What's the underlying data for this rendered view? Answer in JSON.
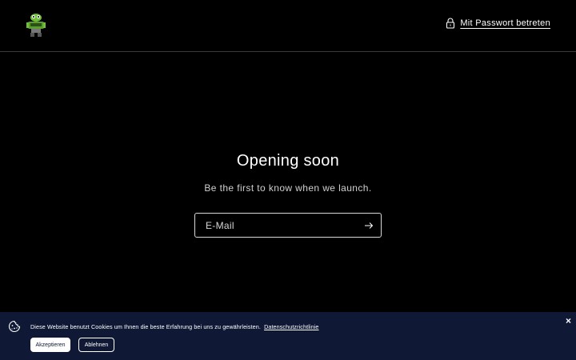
{
  "header": {
    "logo_icon": "robot-mascot-icon",
    "lock_icon": "lock-icon",
    "password_link": "Mit Passwort betreten"
  },
  "main": {
    "title": "Opening soon",
    "subtitle": "Be the first to know when we launch.",
    "email_placeholder": "E-Mail",
    "submit_icon": "arrow-right-icon"
  },
  "cookie_banner": {
    "icon": "cookie-icon",
    "text": "Diese Website benutzt Cookies um Ihnen die beste Erfahrung bei uns zu gewährleisten.",
    "privacy_link": "Datenschutzrichtlinie",
    "accept_label": "Akzeptieren",
    "decline_label": "Ablehnen",
    "close_label": "×",
    "background": "#0f1935"
  }
}
